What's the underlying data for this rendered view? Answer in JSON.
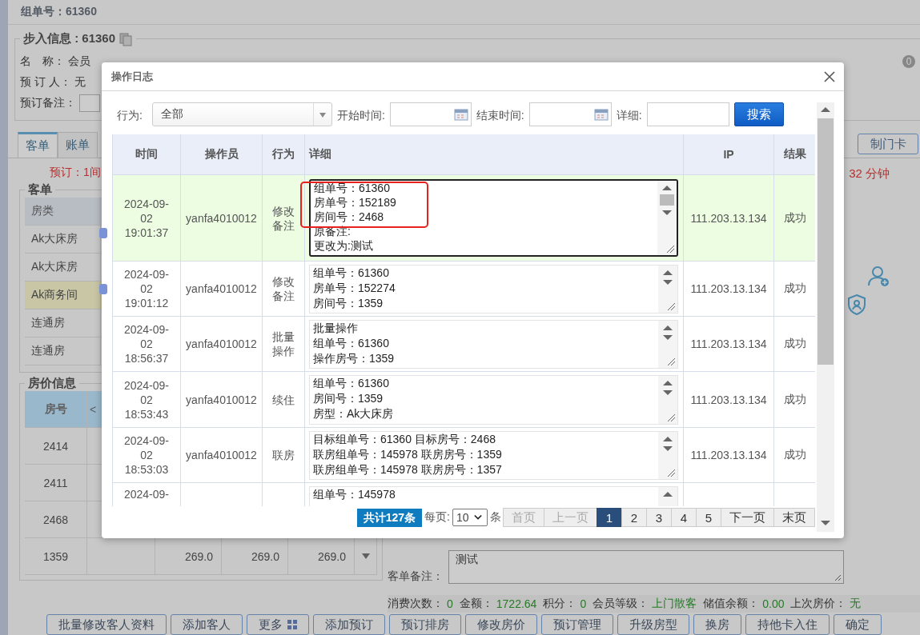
{
  "background": {
    "title": "组单号：61360",
    "checkin_info": {
      "legend": "步入信息 : 61360",
      "name_label": "名　称：",
      "name_value": "会员",
      "booker_label": "预 订 人：",
      "booker_value": "无",
      "remark_label": "预订备注：",
      "count_badge": "0"
    },
    "tabs": [
      {
        "label": "客单",
        "selected": true
      },
      {
        "label": "账单",
        "selected": false
      }
    ],
    "right_buttons": [
      "制门卡"
    ],
    "booking_note": "预订：1间",
    "elapsed": "32 分钟",
    "guest_list": {
      "legend": "客单",
      "column": "房类",
      "rows": [
        {
          "room_type": "Ak大床房",
          "badge": true,
          "highlighted": false
        },
        {
          "room_type": "Ak大床房",
          "badge": false,
          "highlighted": false
        },
        {
          "room_type": "Ak商务间",
          "badge": true,
          "highlighted": true
        },
        {
          "room_type": "连通房",
          "badge": false,
          "highlighted": false
        },
        {
          "room_type": "连通房",
          "badge": false,
          "highlighted": false
        }
      ]
    },
    "price_info": {
      "legend": "房价信息",
      "columns": [
        "房号",
        "<"
      ],
      "rows": [
        {
          "room": "2414"
        },
        {
          "room": "2411"
        },
        {
          "room": "2468"
        },
        {
          "room": "1359",
          "prices": [
            "269.0",
            "269.0",
            "269.0"
          ]
        }
      ]
    },
    "guest_remark": {
      "label": "客单备注：",
      "value": "测试"
    },
    "stats": [
      {
        "label": "消费次数：",
        "value": "0"
      },
      {
        "label": "金额：",
        "value": "1722.64"
      },
      {
        "label": "积分：",
        "value": "0"
      },
      {
        "label": "会员等级：",
        "value": "上门散客"
      },
      {
        "label": "储值余额：",
        "value": "0.00"
      },
      {
        "label": "上次房价：",
        "value": "无"
      }
    ],
    "buttons": [
      {
        "label": "批量修改客人资料",
        "kind": "plain"
      },
      {
        "label": "添加客人",
        "kind": "plain"
      },
      {
        "label": "更多",
        "kind": "menu"
      },
      {
        "label": "添加预订",
        "kind": "plain"
      },
      {
        "label": "预订排房",
        "kind": "plain"
      },
      {
        "label": "修改房价",
        "kind": "plain"
      },
      {
        "label": "预订管理",
        "kind": "plain"
      },
      {
        "label": "升级房型",
        "kind": "plain"
      },
      {
        "label": "换房",
        "kind": "plain"
      },
      {
        "label": "持他卡入住",
        "kind": "plain"
      },
      {
        "label": "确定",
        "kind": "plain"
      }
    ]
  },
  "dialog": {
    "title": "操作日志",
    "filters": {
      "action_label": "行为:",
      "action_value": "全部",
      "start_label": "开始时间:",
      "end_label": "结束时间:",
      "detail_label": "详细:",
      "search_button": "搜索"
    },
    "table": {
      "columns": [
        "时间",
        "操作员",
        "行为",
        "详细",
        "IP",
        "结果"
      ],
      "rows": [
        {
          "date": "2024-09-02",
          "time": "19:01:37",
          "operator": "yanfa4010012",
          "action": "修改备注",
          "detail": [
            "组单号：61360",
            "房单号：152189",
            "房间号：2468",
            "原备注:",
            "更改为:测试"
          ],
          "ip": "111.203.13.134",
          "result": "成功",
          "selected": true,
          "annotated": true
        },
        {
          "date": "2024-09-02",
          "time": "19:01:12",
          "operator": "yanfa4010012",
          "action": "修改备注",
          "detail": [
            "组单号：61360",
            "房单号：152274",
            "房间号：1359"
          ],
          "ip": "111.203.13.134",
          "result": "成功",
          "selected": false,
          "annotated": false
        },
        {
          "date": "2024-09-02",
          "time": "18:56:37",
          "operator": "yanfa4010012",
          "action": "批量操作",
          "detail": [
            "批量操作",
            "组单号：61360",
            "操作房号：1359"
          ],
          "ip": "111.203.13.134",
          "result": "成功",
          "selected": false,
          "annotated": false
        },
        {
          "date": "2024-09-02",
          "time": "18:53:43",
          "operator": "yanfa4010012",
          "action": "续住",
          "detail": [
            "组单号：61360",
            "房间号：1359",
            "房型：Ak大床房"
          ],
          "ip": "111.203.13.134",
          "result": "成功",
          "selected": false,
          "annotated": false
        },
        {
          "date": "2024-09-02",
          "time": "18:53:03",
          "operator": "yanfa4010012",
          "action": "联房",
          "detail": [
            "目标组单号：61360 目标房号：2468",
            "联房组单号：145978 联房房号：1359",
            "联房组单号：145978 联房房号：1357"
          ],
          "ip": "111.203.13.134",
          "result": "成功",
          "selected": false,
          "annotated": false
        },
        {
          "date": "2024-09-",
          "detail": [
            "组单号：145978"
          ],
          "selected": false,
          "annotated": false
        }
      ]
    },
    "pagination": {
      "total": "共计127条",
      "per_page_label": "每页:",
      "per_page": "10",
      "unit": "条",
      "first": {
        "label": "首页",
        "disabled": true
      },
      "prev": {
        "label": "上一页",
        "disabled": true
      },
      "pages": [
        {
          "label": "1",
          "selected": true
        },
        {
          "label": "2",
          "selected": false
        },
        {
          "label": "3",
          "selected": false
        },
        {
          "label": "4",
          "selected": false
        },
        {
          "label": "5",
          "selected": false
        }
      ],
      "next": {
        "label": "下一页",
        "disabled": false
      },
      "last": {
        "label": "末页",
        "disabled": false
      }
    }
  }
}
